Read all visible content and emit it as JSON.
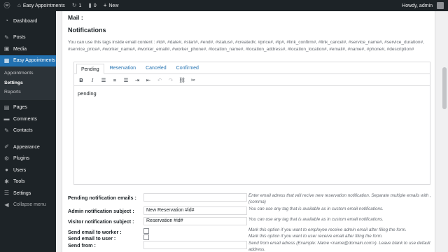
{
  "adminbar": {
    "site_name": "Easy Appointments",
    "updates_count": "1",
    "comments_count": "0",
    "new_label": "New",
    "howdy": "Howdy, admin"
  },
  "sidebar": {
    "items": [
      {
        "label": "Dashboard",
        "icon": "dashboard-icon"
      },
      {
        "label": "Posts",
        "icon": "pin-icon"
      },
      {
        "label": "Media",
        "icon": "media-icon"
      },
      {
        "label": "Easy Appointments",
        "icon": "calendar-icon"
      },
      {
        "label": "Pages",
        "icon": "page-icon"
      },
      {
        "label": "Comments",
        "icon": "comment-icon"
      },
      {
        "label": "Contacts",
        "icon": "pin-icon"
      },
      {
        "label": "Appearance",
        "icon": "brush-icon"
      },
      {
        "label": "Plugins",
        "icon": "plugin-icon"
      },
      {
        "label": "Users",
        "icon": "users-icon"
      },
      {
        "label": "Tools",
        "icon": "wrench-icon"
      },
      {
        "label": "Settings",
        "icon": "settings-icon"
      },
      {
        "label": "Collapse menu",
        "icon": "collapse-icon"
      }
    ],
    "submenu": [
      "Appointments",
      "Settings",
      "Reports"
    ]
  },
  "main": {
    "mail_label": "Mail :",
    "section_title": "Notifications",
    "tags_text": "You can use this tags inside email content : #id#, #date#, #start#, #end#, #status#, #created#, #price#, #ip#, #link_confirm#, #link_cancel#, #service_name#, #service_duration#, #service_price#, #worker_name#, #worker_email#, #worker_phone#, #location_name#, #location_address#, #location_location#, #email#, #name#, #phone#, #description#",
    "tabs": [
      "Pending",
      "Reservation",
      "Canceled",
      "Confirmed"
    ],
    "editor_content": "pending"
  },
  "form": {
    "pending_email_label": "Pending notification emails :",
    "pending_email_value": "",
    "pending_email_hint": "Enter email adress that will recive new reservation notification. Separate multiple emails with , (comma)",
    "admin_subject_label": "Admin notification subject :",
    "admin_subject_value": "New Reservation #id#",
    "admin_subject_hint": "You can use any tag that is available as in custom email notifications.",
    "visitor_subject_label": "Visitor notification subject :",
    "visitor_subject_value": "Reservation #id#",
    "visitor_subject_hint": "You can use any tag that is available as in custom email notifications.",
    "send_worker_label": "Send email to worker :",
    "send_worker_hint": "Mark this option if you want to employee receive admin email after filing the form.",
    "send_user_label": "Send email to user :",
    "send_user_hint": "Mark this option if you want to user receive email after filing the form.",
    "send_from_label": "Send from :",
    "send_from_value": "",
    "send_from_hint": "Send from email adress (Example: Name <name@domain.com>). Leave blank to use default address."
  },
  "colors": {
    "accent": "#2271b1",
    "sidebar_bg": "#1d2327",
    "link": "#2271b1"
  }
}
